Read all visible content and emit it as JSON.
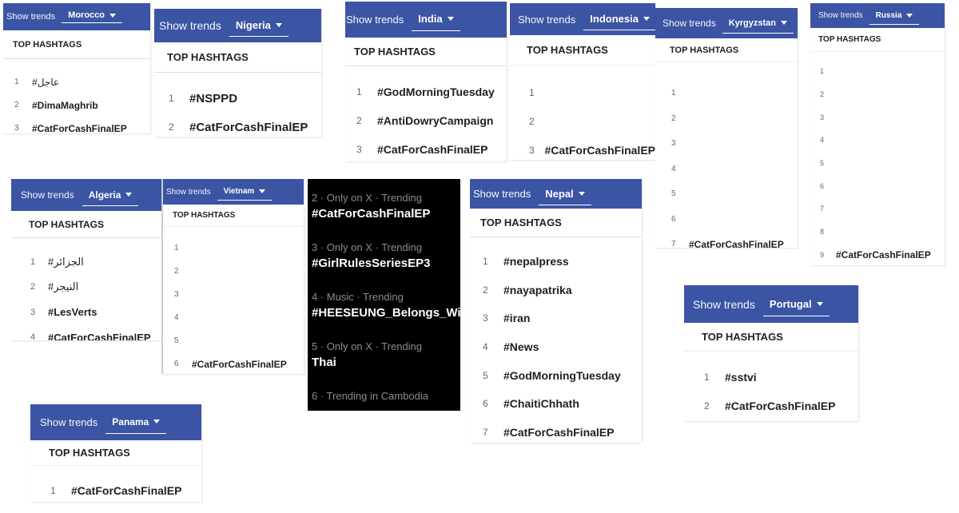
{
  "common": {
    "show_trends_label": "Show trends",
    "top_hashtags_label": "TOP HASHTAGS"
  },
  "colors": {
    "bar": "#3b55a4",
    "dark_panel": "#000000"
  },
  "icons": {
    "dropdown": "chevron-down-icon"
  },
  "panels": {
    "morocco": {
      "country": "Morocco",
      "rows": [
        {
          "rank": "1",
          "tag": "#عاجل"
        },
        {
          "rank": "2",
          "tag": "#DimaMaghrib"
        },
        {
          "rank": "3",
          "tag": "#CatForCashFinalEP"
        }
      ]
    },
    "nigeria": {
      "country": "Nigeria",
      "rows": [
        {
          "rank": "1",
          "tag": "#NSPPD"
        },
        {
          "rank": "2",
          "tag": "#CatForCashFinalEP"
        }
      ]
    },
    "india": {
      "country": "India",
      "rows": [
        {
          "rank": "1",
          "tag": "#GodMorningTuesday"
        },
        {
          "rank": "2",
          "tag": "#AntiDowryCampaign"
        },
        {
          "rank": "3",
          "tag": "#CatForCashFinalEP"
        }
      ]
    },
    "indonesia": {
      "country": "Indonesia",
      "rows": [
        {
          "rank": "1",
          "tag": ""
        },
        {
          "rank": "2",
          "tag": ""
        },
        {
          "rank": "3",
          "tag": "#CatForCashFinalEP"
        }
      ]
    },
    "kyrgyzstan": {
      "country": "Kyrgyzstan",
      "rows": [
        {
          "rank": "1",
          "tag": ""
        },
        {
          "rank": "2",
          "tag": ""
        },
        {
          "rank": "3",
          "tag": ""
        },
        {
          "rank": "4",
          "tag": ""
        },
        {
          "rank": "5",
          "tag": ""
        },
        {
          "rank": "6",
          "tag": ""
        },
        {
          "rank": "7",
          "tag": "#CatForCashFinalEP"
        }
      ]
    },
    "russia": {
      "country": "Russia",
      "rows": [
        {
          "rank": "1",
          "tag": ""
        },
        {
          "rank": "2",
          "tag": ""
        },
        {
          "rank": "3",
          "tag": ""
        },
        {
          "rank": "4",
          "tag": ""
        },
        {
          "rank": "5",
          "tag": ""
        },
        {
          "rank": "6",
          "tag": ""
        },
        {
          "rank": "7",
          "tag": ""
        },
        {
          "rank": "8",
          "tag": ""
        },
        {
          "rank": "9",
          "tag": "#CatForCashFinalEP"
        }
      ]
    },
    "algeria": {
      "country": "Algeria",
      "rows": [
        {
          "rank": "1",
          "tag": "#الجزائر"
        },
        {
          "rank": "2",
          "tag": "#النيجر"
        },
        {
          "rank": "3",
          "tag": "#LesVerts"
        },
        {
          "rank": "4",
          "tag": "#CatForCashFinalEP"
        }
      ]
    },
    "vietnam": {
      "country": "Vietnam",
      "rows": [
        {
          "rank": "1",
          "tag": ""
        },
        {
          "rank": "2",
          "tag": ""
        },
        {
          "rank": "3",
          "tag": ""
        },
        {
          "rank": "4",
          "tag": ""
        },
        {
          "rank": "5",
          "tag": ""
        },
        {
          "rank": "6",
          "tag": "#CatForCashFinalEP"
        }
      ]
    },
    "nepal": {
      "country": "Nepal",
      "rows": [
        {
          "rank": "1",
          "tag": "#nepalpress"
        },
        {
          "rank": "2",
          "tag": "#nayapatrika"
        },
        {
          "rank": "3",
          "tag": "#iran"
        },
        {
          "rank": "4",
          "tag": "#News"
        },
        {
          "rank": "5",
          "tag": "#GodMorningTuesday"
        },
        {
          "rank": "6",
          "tag": "#ChaitiChhath"
        },
        {
          "rank": "7",
          "tag": "#CatForCashFinalEP"
        }
      ]
    },
    "portugal": {
      "country": "Portugal",
      "rows": [
        {
          "rank": "1",
          "tag": "#sstvi"
        },
        {
          "rank": "2",
          "tag": "#CatForCashFinalEP"
        }
      ]
    },
    "panama": {
      "country": "Panama",
      "rows": [
        {
          "rank": "1",
          "tag": "#CatForCashFinalEP"
        }
      ]
    }
  },
  "cambodia_x": {
    "items": [
      {
        "meta": "2 · Only on X · Trending",
        "name": "#CatForCashFinalEP"
      },
      {
        "meta": "3 · Only on X · Trending",
        "name": "#GirlRulesSeriesEP3"
      },
      {
        "meta": "4 · Music · Trending",
        "name": "#HEESEUNG_Belongs_With_"
      },
      {
        "meta": "5 · Only on X · Trending",
        "name": "Thai"
      },
      {
        "meta": "6 · Trending in Cambodia",
        "name": ""
      }
    ]
  }
}
